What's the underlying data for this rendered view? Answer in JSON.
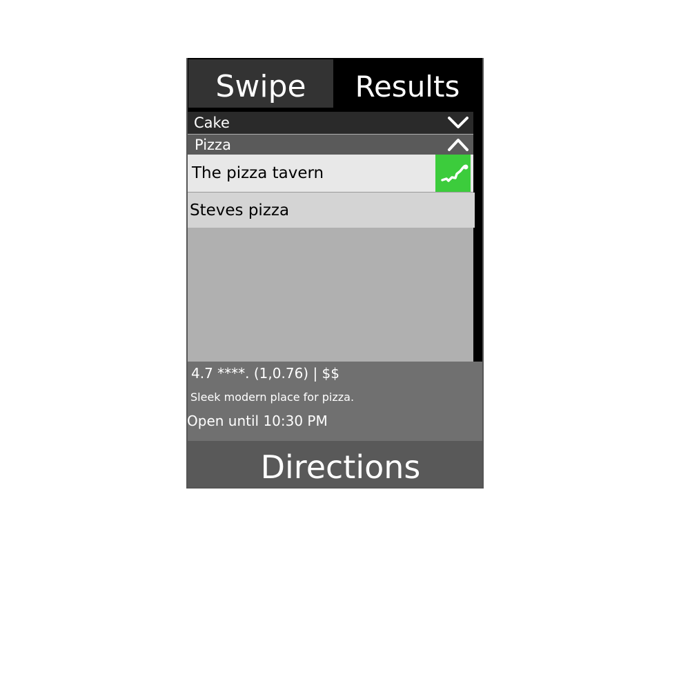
{
  "tabs": {
    "swipe_label": "Swipe",
    "results_label": "Results"
  },
  "categories": [
    {
      "label": "Cake",
      "expanded": false
    },
    {
      "label": "Pizza",
      "expanded": true
    }
  ],
  "results": [
    {
      "name": "The pizza tavern",
      "selected": true
    },
    {
      "name": "Steves pizza",
      "selected": false
    }
  ],
  "details": {
    "rating_line": "4.7 ****. (1,0.76) | $$",
    "description": "Sleek modern place for pizza.",
    "hours": "Open until 10:30 PM"
  },
  "directions_label": "Directions",
  "icons": {
    "cake_chevron": "chevron-down-icon",
    "pizza_chevron": "chevron-up-icon",
    "route": "route-icon"
  },
  "colors": {
    "route_button": "#3ccc3c",
    "tab_active": "#000000",
    "tab_inactive": "#333333"
  }
}
